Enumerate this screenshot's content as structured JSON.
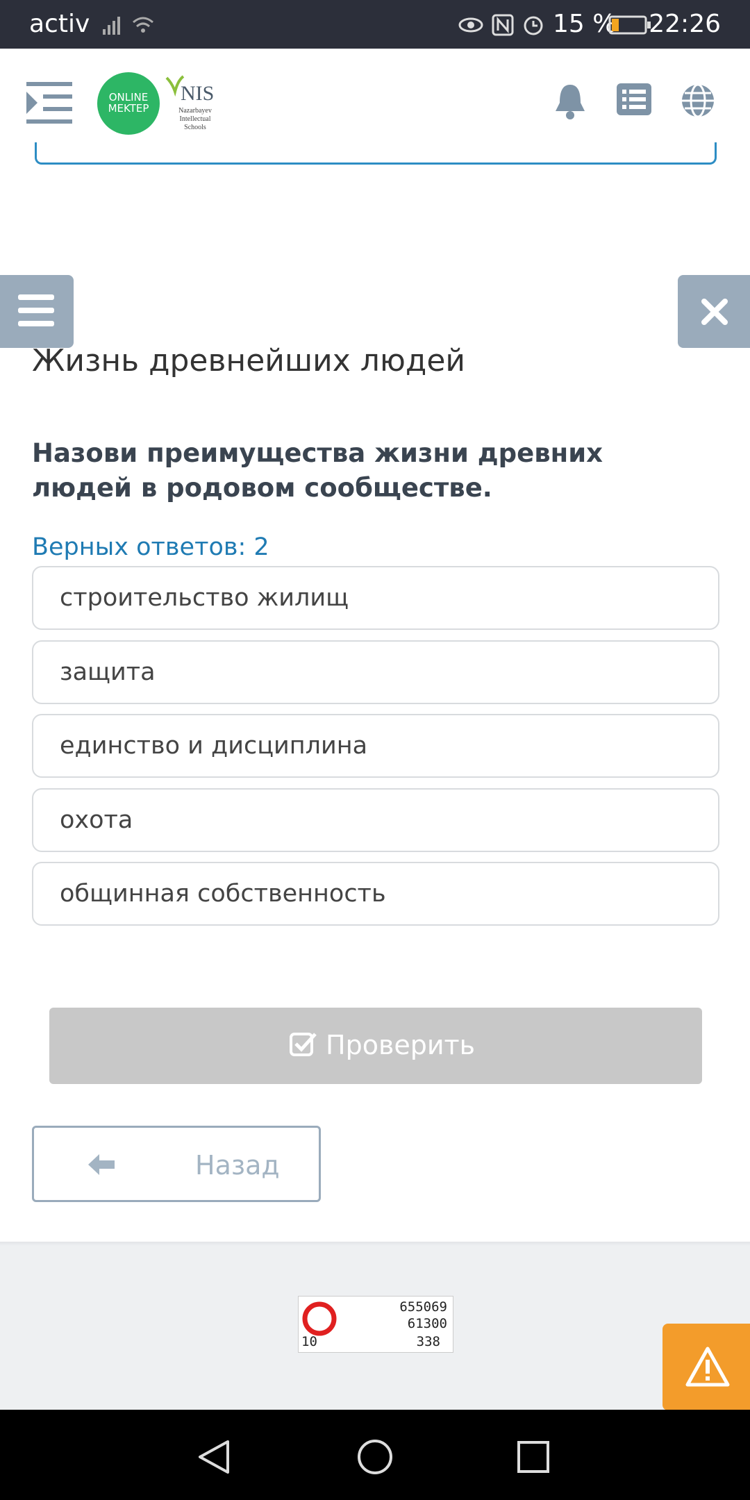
{
  "status_bar": {
    "carrier": "activ",
    "battery": "15 %",
    "time": "22:26"
  },
  "header": {
    "logo_online_line1": "ONLINE",
    "logo_online_line2": "MEKTEP",
    "logo_nis": "NIS",
    "logo_nis_sub1": "Nazarbayev",
    "logo_nis_sub2": "Intellectual",
    "logo_nis_sub3": "Schools"
  },
  "lesson": {
    "title": "Жизнь древнейших людей",
    "question": "Назови преимущества жизни древних людей в родовом сообществе.",
    "correct_count": "Верных ответов: 2",
    "options": [
      "строительство жилищ",
      "защита",
      "единство и дисциплина",
      "охота",
      "общинная собственность"
    ],
    "check_label": "Проверить",
    "back_label": "Назад"
  },
  "counter_widget": {
    "line1": "655069",
    "line2": "61300",
    "line3_left": "10",
    "line3_right": "338"
  },
  "colors": {
    "accent_blue": "#1f7bb3",
    "gray_button": "#9aabbb",
    "warning": "#f39c2b",
    "logo_green": "#2db665"
  }
}
